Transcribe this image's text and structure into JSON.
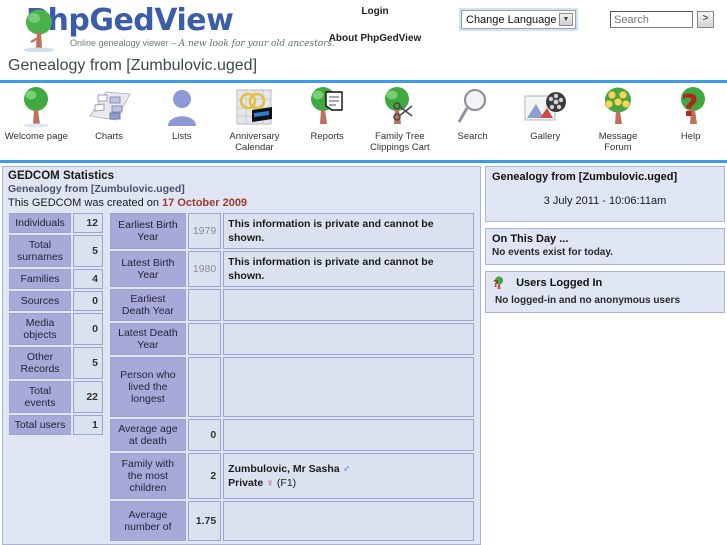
{
  "header": {
    "brand": "PhpGedView",
    "tagline_plain": "Online genealogy viewer – ",
    "tagline_italic": "A new look for your old ancestors.",
    "login_label": "Login",
    "about_label": "About PhpGedView",
    "language_selected": "Change Language",
    "search_placeholder": "Search",
    "search_value": "",
    "search_go_label": ">"
  },
  "page": {
    "title": "Genealogy from [Zumbulovic.uged]"
  },
  "nav": {
    "items": [
      {
        "label": "Welcome page",
        "icon": "tree-icon"
      },
      {
        "label": "Charts",
        "icon": "chart-boxes-icon"
      },
      {
        "label": "Lists",
        "icon": "person-icon"
      },
      {
        "label": "Anniversary\nCalendar",
        "label_line1": "Anniversary",
        "label_line2": "Calendar",
        "icon": "calendar-rings-icon"
      },
      {
        "label": "Reports",
        "icon": "tree-document-icon"
      },
      {
        "label": "Family Tree\nClippings Cart",
        "label_line1": "Family Tree",
        "label_line2": "Clippings Cart",
        "icon": "tree-scissors-icon"
      },
      {
        "label": "Search",
        "icon": "magnifier-icon"
      },
      {
        "label": "Gallery",
        "icon": "photo-film-icon"
      },
      {
        "label": "Message\nForum",
        "label_line1": "Message",
        "label_line2": "Forum",
        "icon": "tree-faces-icon"
      },
      {
        "label": "Help",
        "icon": "tree-question-icon"
      }
    ]
  },
  "stats": {
    "title": "GEDCOM Statistics",
    "subtitle": "Genealogy from [Zumbulovic.uged]",
    "created_prefix": "This GEDCOM was created on ",
    "created_date": "17 October 2009",
    "summary_rows": [
      {
        "label": "Individuals",
        "value": "12"
      },
      {
        "label": "Total surnames",
        "value": "5"
      },
      {
        "label": "Families",
        "value": "4"
      },
      {
        "label": "Sources",
        "value": "0"
      },
      {
        "label": "Media objects",
        "value": "0"
      },
      {
        "label": "Other Records",
        "value": "5"
      },
      {
        "label": "Total events",
        "value": "22"
      },
      {
        "label": "Total users",
        "value": "1"
      }
    ],
    "detail_rows": [
      {
        "label": "Earliest Birth Year",
        "value": "1979",
        "dim": true,
        "note": "This information is private and cannot be shown."
      },
      {
        "label": "Latest Birth Year",
        "value": "1980",
        "dim": true,
        "note": "This information is private and cannot be shown."
      },
      {
        "label": "Earliest Death Year",
        "value": "",
        "dim": false,
        "note": ""
      },
      {
        "label": "Latest Death Year",
        "value": "",
        "dim": false,
        "note": ""
      },
      {
        "label": "Person who lived the longest",
        "value": "",
        "dim": false,
        "note": ""
      },
      {
        "label": "Average age at death",
        "value": "0",
        "dim": false,
        "note": ""
      },
      {
        "label": "Family with the most children",
        "value": "2",
        "dim": false,
        "note": ""
      },
      {
        "label": "Average number of",
        "value": "1.75",
        "dim": false,
        "note": ""
      }
    ],
    "most_children_family": {
      "husband_name": "Zumbulovic, Mr Sasha",
      "husband_sex_symbol": "♂",
      "wife_name": "Private",
      "wife_sex_symbol": "♀",
      "family_id": "(F1)"
    }
  },
  "sidebar": {
    "gedcom_panel": {
      "title": "Genealogy from [Zumbulovic.uged]",
      "datetime": "3 July 2011 - 10:06:11am"
    },
    "on_this_day_panel": {
      "title": "On This Day ...",
      "text": "No events exist for today."
    },
    "users_panel": {
      "icon": "tree-person-icon",
      "title": "Users Logged In",
      "text": "No logged-in and no anonymous users"
    }
  },
  "colors": {
    "accent_blue": "#3d9bec",
    "panel_bg": "#dfe5f2",
    "panel_border": "#a9b3d6",
    "label_cell": "#a7a9d8",
    "value_cell": "#dbe2ef",
    "date_red": "#9e3a2e",
    "male_blue": "#2b5fd9",
    "female_pink": "#c22a5c"
  }
}
